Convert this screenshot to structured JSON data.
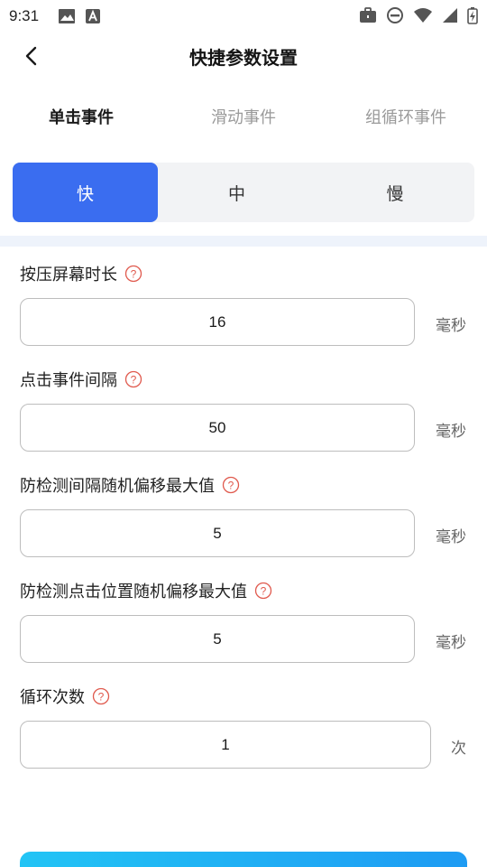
{
  "status_bar": {
    "time": "9:31",
    "left_icons": [
      "image-icon",
      "accessibility-a-icon"
    ],
    "right_icons": [
      "briefcase-icon",
      "do-not-disturb-icon",
      "wifi-icon",
      "signal-icon",
      "battery-charging-icon"
    ]
  },
  "header": {
    "title": "快捷参数设置"
  },
  "tabs": [
    {
      "label": "单击事件",
      "active": true
    },
    {
      "label": "滑动事件",
      "active": false
    },
    {
      "label": "组循环事件",
      "active": false
    }
  ],
  "speed": {
    "options": [
      {
        "label": "快",
        "active": true
      },
      {
        "label": "中",
        "active": false
      },
      {
        "label": "慢",
        "active": false
      }
    ]
  },
  "fields": [
    {
      "label": "按压屏幕时长",
      "value": "16",
      "unit": "毫秒"
    },
    {
      "label": "点击事件间隔",
      "value": "50",
      "unit": "毫秒"
    },
    {
      "label": "防检测间隔随机偏移最大值",
      "value": "5",
      "unit": "毫秒"
    },
    {
      "label": "防检测点击位置随机偏移最大值",
      "value": "5",
      "unit": "毫秒"
    },
    {
      "label": "循环次数",
      "value": "1",
      "unit": "次"
    }
  ],
  "colors": {
    "accent": "#3a6df0",
    "help_icon": "#e05a4e",
    "confirm_gradient_start": "#22c4f5",
    "confirm_gradient_end": "#1e9bf3"
  }
}
